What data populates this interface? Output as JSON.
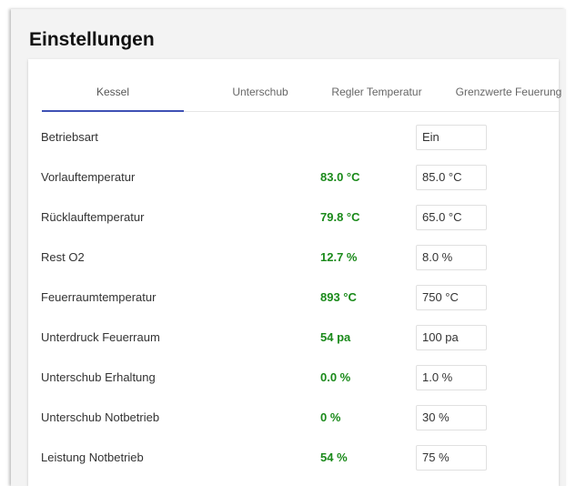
{
  "page": {
    "title": "Einstellungen"
  },
  "tabs": [
    {
      "label": "Kessel",
      "active": true
    },
    {
      "label": "Unterschub",
      "active": false
    },
    {
      "label": "Regler Temperatur",
      "active": false
    },
    {
      "label": "Grenzwerte Feuerung",
      "active": false
    }
  ],
  "colors": {
    "accent": "#3f51b5",
    "value_green": "#1a8a1a"
  },
  "rows": [
    {
      "label": "Betriebsart",
      "current": "",
      "setting": "Ein"
    },
    {
      "label": "Vorlauftemperatur",
      "current": "83.0 °C",
      "setting": "85.0 °C"
    },
    {
      "label": "Rücklauftemperatur",
      "current": "79.8 °C",
      "setting": "65.0 °C"
    },
    {
      "label": "Rest O2",
      "current": "12.7 %",
      "setting": "8.0 %"
    },
    {
      "label": "Feuerraumtemperatur",
      "current": "893 °C",
      "setting": "750 °C"
    },
    {
      "label": "Unterdruck Feuerraum",
      "current": "54 pa",
      "setting": "100 pa"
    },
    {
      "label": "Unterschub Erhaltung",
      "current": "0.0 %",
      "setting": "1.0 %"
    },
    {
      "label": "Unterschub Notbetrieb",
      "current": "0 %",
      "setting": "30 %"
    },
    {
      "label": "Leistung Notbetrieb",
      "current": "54 %",
      "setting": "75 %"
    }
  ]
}
